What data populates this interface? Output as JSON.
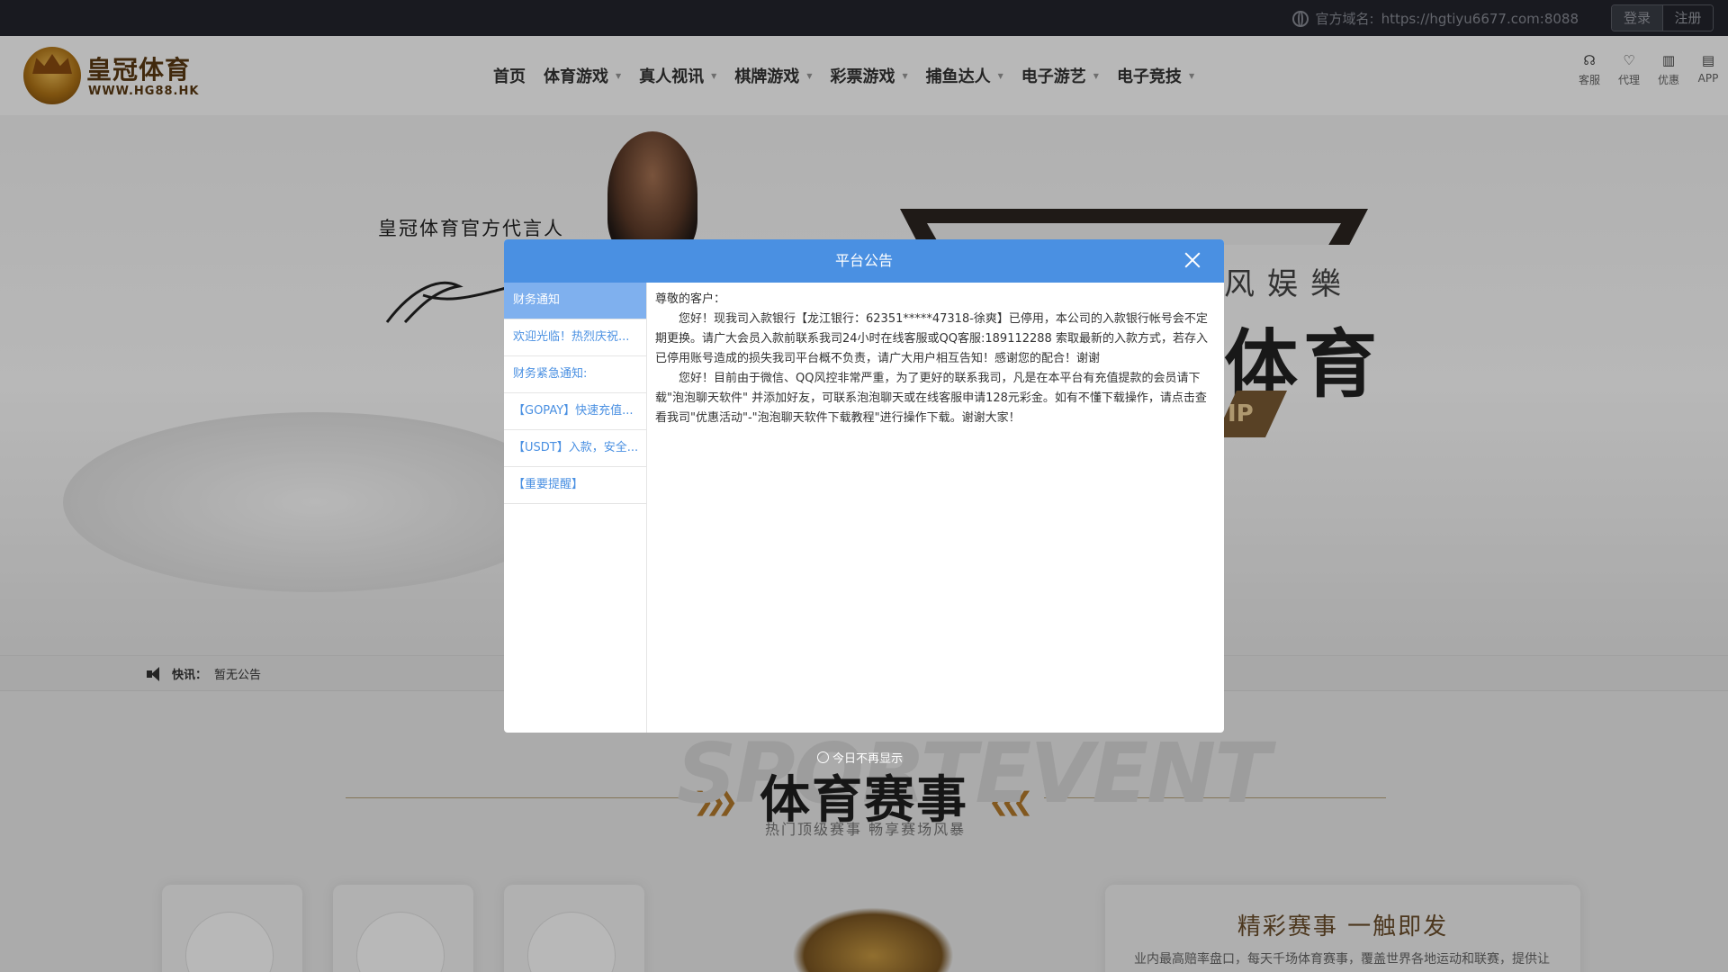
{
  "topbar": {
    "domain_label": "官方域名:",
    "domain_url": "https://hgtiyu6677.com:8088",
    "login": "登录",
    "register": "注册"
  },
  "header": {
    "logo_cn": "皇冠体育",
    "logo_en": "WWW.HG88.HK",
    "nav": [
      {
        "label": "首页",
        "has_dropdown": false
      },
      {
        "label": "体育游戏",
        "has_dropdown": true
      },
      {
        "label": "真人视讯",
        "has_dropdown": true
      },
      {
        "label": "棋牌游戏",
        "has_dropdown": true
      },
      {
        "label": "彩票游戏",
        "has_dropdown": true
      },
      {
        "label": "捕鱼达人",
        "has_dropdown": true
      },
      {
        "label": "电子游艺",
        "has_dropdown": true
      },
      {
        "label": "电子竞技",
        "has_dropdown": true
      }
    ],
    "quick": [
      {
        "label": "客服",
        "icon": "headset-icon"
      },
      {
        "label": "代理",
        "icon": "handshake-icon"
      },
      {
        "label": "优惠",
        "icon": "gift-icon"
      },
      {
        "label": "APP",
        "icon": "app-icon"
      }
    ]
  },
  "banner": {
    "spokesperson": "皇冠体育官方代言人",
    "slogan_top": "风娱樂",
    "slogan_main": "体育",
    "vip": "IP"
  },
  "ticker": {
    "label": "快讯：",
    "text": "暂无公告"
  },
  "events": {
    "bg_text": "SPORTEVENT",
    "title": "体育赛事",
    "subtitle": "热门顶级赛事 畅享赛场风暴",
    "promo_title": "精彩赛事 一触即发",
    "promo_text": "业内最高赔率盘口，每天千场体育赛事，覆盖世界各地运动和联赛，提供让"
  },
  "modal": {
    "title": "平台公告",
    "tabs": [
      "财务通知",
      "欢迎光临！热烈庆祝...",
      "财务紧急通知:",
      "【GOPAY】快速充值...",
      "【USDT】入款，安全...",
      "【重要提醒】"
    ],
    "greeting": "尊敬的客户：",
    "para1": "您好！现我司入款银行【龙江银行：62351*****47318-徐爽】已停用，本公司的入款银行帐号会不定期更换。请广大会员入款前联系我司24小时在线客服或QQ客服:189112288  索取最新的入款方式，若存入已停用账号造成的损失我司平台概不负责，请广大用户相互告知！感谢您的配合！谢谢",
    "para2": "您好！目前由于微信、QQ风控非常严重，为了更好的联系我司，凡是在本平台有充值提款的会员请下载\"泡泡聊天软件\" 并添加好友，可联系泡泡聊天或在线客服申请128元彩金。如有不懂下载操作，请点击查看我司\"优惠活动\"-\"泡泡聊天软件下载教程\"进行操作下载。谢谢大家！"
  },
  "dont_show": "今日不再显示",
  "colors": {
    "modal_header": "#4a90e2",
    "tab_active": "#7fb0ee",
    "topbar": "#23252d"
  }
}
